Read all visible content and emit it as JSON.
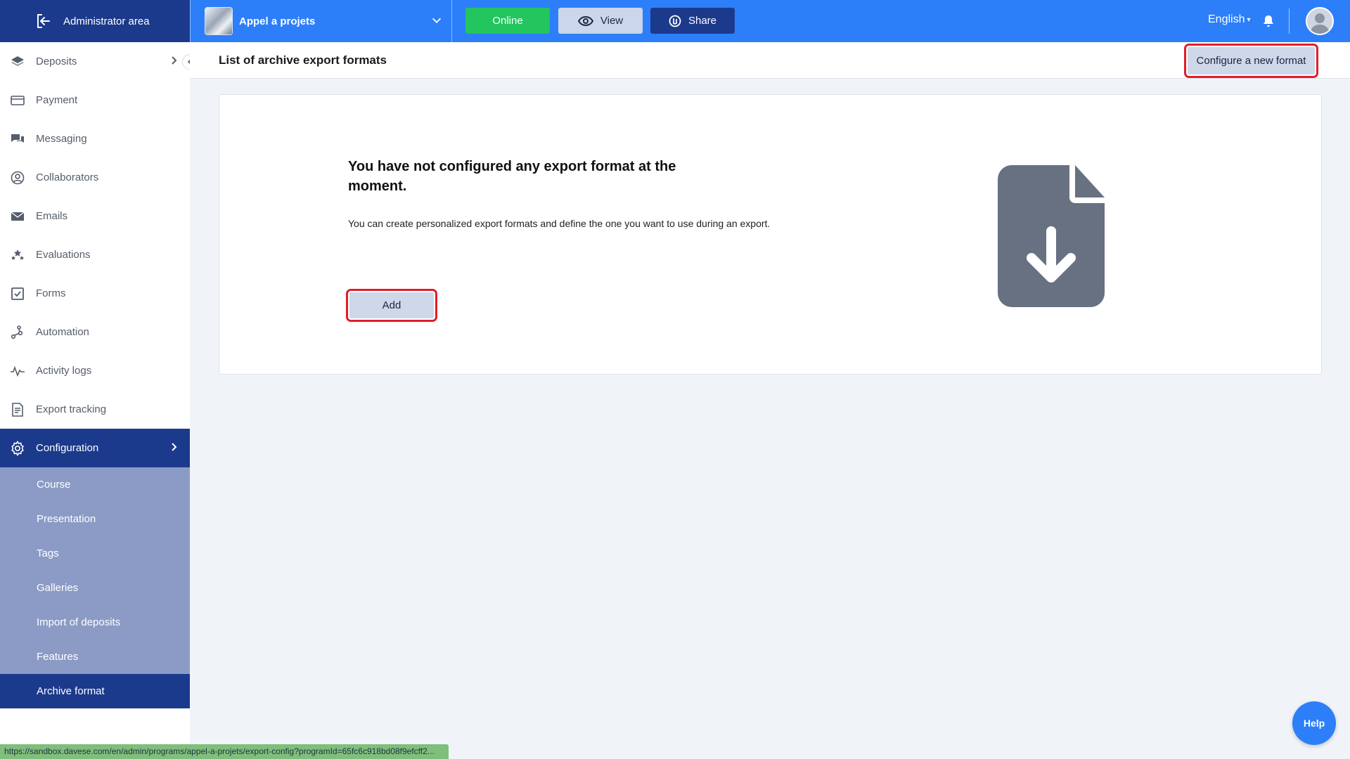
{
  "topbar": {
    "admin_label": "Administrator area",
    "program_name": "Appel a projets",
    "online_label": "Online",
    "view_label": "View",
    "share_label": "Share",
    "language": "English",
    "accent": "#2d7ff9",
    "dark": "#1c3a8c"
  },
  "sidebar": {
    "items": [
      {
        "label": "Deposits",
        "icon": "layers-icon"
      },
      {
        "label": "Payment",
        "icon": "card-icon"
      },
      {
        "label": "Messaging",
        "icon": "chat-icon"
      },
      {
        "label": "Collaborators",
        "icon": "user-circle-icon"
      },
      {
        "label": "Emails",
        "icon": "envelope-icon"
      },
      {
        "label": "Evaluations",
        "icon": "stars-icon"
      },
      {
        "label": "Forms",
        "icon": "checkbox-icon"
      },
      {
        "label": "Automation",
        "icon": "flow-icon"
      },
      {
        "label": "Activity logs",
        "icon": "pulse-icon"
      },
      {
        "label": "Export tracking",
        "icon": "document-icon"
      },
      {
        "label": "Configuration",
        "icon": "gear-icon"
      }
    ],
    "sub_items": [
      {
        "label": "Course"
      },
      {
        "label": "Presentation"
      },
      {
        "label": "Tags"
      },
      {
        "label": "Galleries"
      },
      {
        "label": "Import of deposits"
      },
      {
        "label": "Features"
      },
      {
        "label": "Archive format"
      }
    ]
  },
  "page": {
    "title": "List of archive export formats",
    "configure_label": "Configure a new format"
  },
  "empty_state": {
    "heading": "You have not configured any export format at the moment.",
    "text": "You can create personalized export formats and define the one you want to use during an export.",
    "add_label": "Add",
    "icon": "file-download-icon"
  },
  "statusbar": {
    "url": "https://sandbox.davese.com/en/admin/programs/appel-a-projets/export-config?programId=65fc6c918bd08f9efcff2..."
  },
  "help_label": "Help"
}
